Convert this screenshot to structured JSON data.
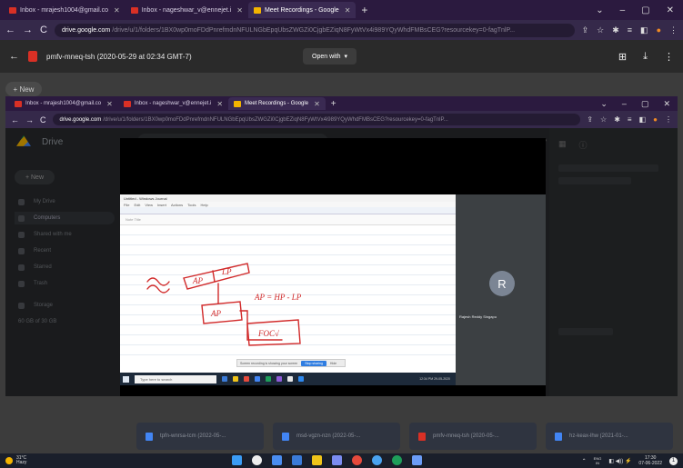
{
  "outer_browser": {
    "tabs": [
      {
        "label": "Inbox - mrajesh1004@gmail.co",
        "active": false,
        "favicon_color": "#d93025"
      },
      {
        "label": "Inbox - nageshwar_v@ennejet.i",
        "active": false,
        "favicon_color": "#d93025"
      },
      {
        "label": "Meet Recordings - Google",
        "active": true,
        "favicon_color": "#f4b400"
      }
    ],
    "new_tab": "+",
    "window_controls": [
      "⌄",
      "–",
      "▢",
      "✕"
    ],
    "back": "←",
    "forward": "→",
    "reload": "C",
    "url_host": "drive.google.com",
    "url_path": "/drive/u/1/folders/1BX0wp0moFDdPnrefmdnNFULNGbEpqUbsZWGZi0CjgbEZiqN8FyWtVx4i989YQyWhdFMBsCEG?resourcekey=0-fagTnlP...",
    "extension_icons": [
      "⇪",
      "☆",
      "✱",
      "≡",
      "◧",
      "●",
      "⋮"
    ]
  },
  "viewer": {
    "back": "←",
    "file_title": "pmfv-mneq-tsh (2020-05-29 at 02:34 GMT-7)",
    "open_with": "Open with",
    "open_with_arrow": "▾",
    "right_icons": [
      "⊞",
      "⤓",
      "⋮"
    ]
  },
  "outer_drive": {
    "new_label": "+ New",
    "bottom_cards": [
      {
        "label": "tpfn-wnrsa-tcm (2022-05-...",
        "color": "#4285f4"
      },
      {
        "label": "msd-vgzn-nzn (2022-05-...",
        "color": "#4285f4"
      },
      {
        "label": "pmfv-mneq-tsh (2020-05-...",
        "color": "#d93025"
      },
      {
        "label": "hz-keax-lhw (2021-01-...",
        "color": "#4285f4"
      }
    ]
  },
  "inner_browser": {
    "tabs": [
      {
        "label": "Inbox - mrajesh1004@gmail.co",
        "active": false,
        "favicon_color": "#d93025"
      },
      {
        "label": "Inbox - nageshwar_v@ennejet.i",
        "active": false,
        "favicon_color": "#d93025"
      },
      {
        "label": "Meet Recordings - Google",
        "active": true,
        "favicon_color": "#f4b400"
      }
    ],
    "new_tab": "+",
    "window_controls": [
      "⌄",
      "–",
      "▢",
      "✕"
    ],
    "back": "←",
    "forward": "→",
    "reload": "C",
    "url_host": "drive.google.com",
    "url_path": "/drive/u/1/folders/1BX0wp0moFDdPnrefmdnNFULNGbEpqUbsZWGZi0CjgbEZiqN8FyWtVx4i989YQyWhdFMBsCEG?resourcekey=0-fagTnlP...",
    "extension_icons": [
      "⇪",
      "☆",
      "✱",
      "≡",
      "◧",
      "●",
      "⋮"
    ]
  },
  "inner_drive": {
    "app_name": "Drive",
    "search_placeholder": "Search in Drive",
    "new_label": "+ New",
    "sidebar_items": [
      {
        "label": "My Drive",
        "active": false
      },
      {
        "label": "Computers",
        "active": true
      },
      {
        "label": "Shared with me",
        "active": false
      },
      {
        "label": "Recent",
        "active": false
      },
      {
        "label": "Starred",
        "active": false
      },
      {
        "label": "Trash",
        "active": false
      },
      {
        "label": "Storage",
        "active": false
      }
    ],
    "storage_text": "60 GB of 30 GB"
  },
  "recording": {
    "paint_title": "Untitled - Windows Journal",
    "paint_menu": [
      "File",
      "Edit",
      "View",
      "Insert",
      "Actions",
      "Tools",
      "Help"
    ],
    "ruler_text": "Note Title",
    "sketch_labels": {
      "left_box": "AP",
      "right_box": "LP",
      "middle_box": "AP",
      "formula": "AP = HP - LP",
      "bottom_box": "FOC√"
    },
    "toast_text": "Screen recording is showing your screen",
    "toast_button": "Stop sharing",
    "toast_hide": "Hide",
    "win_search": "Type here to search",
    "win_clock": "12:34 PM 29-05-2020",
    "participant_initial": "R",
    "participant_name": "Rajesh Reddy Singapu",
    "win_taskbar_icon_colors": [
      "#3b7bd8",
      "#f0c419",
      "#e64a3c",
      "#4285f4",
      "#1e9e5a",
      "#8e5bd8",
      "#e8e8e8",
      "#2d89ef"
    ]
  },
  "taskbar": {
    "weather_temp": "31°C",
    "weather_desc": "Hazy",
    "app_colors": [
      "#3b9cf5",
      "#eeeeee",
      "#4a8df0",
      "#3b7bd8",
      "#f0c419",
      "#7b8cf0",
      "#e64a3c",
      "#4aa3f0",
      "#1e9e5a",
      "#6b9cf7"
    ],
    "tray_caret": "⌃",
    "lang_top": "ENG",
    "lang_bottom": "IN",
    "tray_icons": "◧ ◀)) ⚡",
    "clock_time": "17:30",
    "clock_date": "07-06-2022",
    "notif_count": "1"
  },
  "colors": {
    "chrome_frame": "#2b1a3f",
    "chrome_toolbar": "#35294a",
    "drive_dark": "#282a2d",
    "meet_tile": "#3c4043",
    "ink_red": "#d12a2a"
  }
}
